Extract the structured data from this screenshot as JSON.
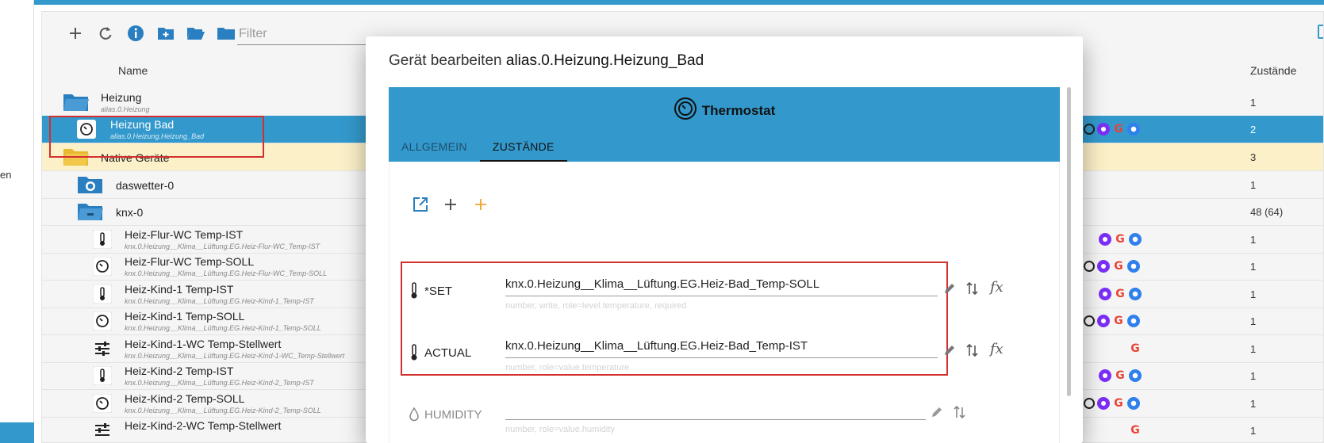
{
  "left_fragment": "en",
  "toolbar": {
    "filter_placeholder": "Filter",
    "icons": [
      "plus-icon",
      "refresh-icon",
      "info-icon",
      "create-folder-icon",
      "open-folder-icon",
      "folder-icon"
    ]
  },
  "columns": {
    "name": "Name",
    "states": "Zustände"
  },
  "rows": [
    {
      "name": "Heizung",
      "sub": "alias.0.Heizung",
      "count": "1",
      "icon": "folder-icon",
      "badges": []
    },
    {
      "name": "Heizung Bad",
      "sub": "alias.0.Heizung.Heizung_Bad",
      "count": "2",
      "icon": "thermostat-icon",
      "badges": [
        "ring",
        "alexa",
        "google",
        "blue"
      ]
    },
    {
      "name": "Native Geräte",
      "sub": "",
      "count": "3",
      "icon": "folder-icon",
      "badges": []
    },
    {
      "name": "daswetter-0",
      "sub": "",
      "count": "1",
      "icon": "weather-icon",
      "badges": []
    },
    {
      "name": "knx-0",
      "sub": "",
      "count": "48 (64)",
      "icon": "folder-icon",
      "badges": []
    },
    {
      "name": "Heiz-Flur-WC Temp-IST",
      "sub": "knx.0.Heizung__Klima__Lüftung.EG.Heiz-Flur-WC_Temp-IST",
      "count": "1",
      "icon": "thermometer-icon",
      "badges": [
        "alexa",
        "google",
        "blue"
      ]
    },
    {
      "name": "Heiz-Flur-WC Temp-SOLL",
      "sub": "knx.0.Heizung__Klima__Lüftung.EG.Heiz-Flur-WC_Temp-SOLL",
      "count": "1",
      "icon": "thermostat-icon",
      "badges": [
        "ring",
        "alexa",
        "google",
        "blue"
      ]
    },
    {
      "name": "Heiz-Kind-1 Temp-IST",
      "sub": "knx.0.Heizung__Klima__Lüftung.EG.Heiz-Kind-1_Temp-IST",
      "count": "1",
      "icon": "thermometer-icon",
      "badges": [
        "alexa",
        "google",
        "blue"
      ]
    },
    {
      "name": "Heiz-Kind-1 Temp-SOLL",
      "sub": "knx.0.Heizung__Klima__Lüftung.EG.Heiz-Kind-1_Temp-SOLL",
      "count": "1",
      "icon": "thermostat-icon",
      "badges": [
        "ring",
        "alexa",
        "google",
        "blue"
      ]
    },
    {
      "name": "Heiz-Kind-1-WC Temp-Stellwert",
      "sub": "knx.0.Heizung__Klima__Lüftung.EG.Heiz-Kind-1-WC_Temp-Stellwert",
      "count": "1",
      "icon": "sliders-icon",
      "badges": [
        "google"
      ]
    },
    {
      "name": "Heiz-Kind-2 Temp-IST",
      "sub": "knx.0.Heizung__Klima__Lüftung.EG.Heiz-Kind-2_Temp-IST",
      "count": "1",
      "icon": "thermometer-icon",
      "badges": [
        "alexa",
        "google",
        "blue"
      ]
    },
    {
      "name": "Heiz-Kind-2 Temp-SOLL",
      "sub": "knx.0.Heizung__Klima__Lüftung.EG.Heiz-Kind-2_Temp-SOLL",
      "count": "1",
      "icon": "thermostat-icon",
      "badges": [
        "ring",
        "alexa",
        "google",
        "blue"
      ]
    },
    {
      "name": "Heiz-Kind-2-WC Temp-Stellwert",
      "sub": "",
      "count": "1",
      "icon": "sliders-icon",
      "badges": [
        "google"
      ]
    }
  ],
  "dialog": {
    "title_prefix": "Gerät bearbeiten",
    "title_path": "alias.0.Heizung.Heizung_Bad",
    "device_type": "Thermostat",
    "tabs": [
      {
        "label": "ALLGEMEIN",
        "active": false
      },
      {
        "label": "ZUSTÄNDE",
        "active": true
      }
    ],
    "states": [
      {
        "label": "*SET",
        "value": "knx.0.Heizung__Klima__Lüftung.EG.Heiz-Bad_Temp-SOLL",
        "hint": "number, write, role=level.temperature, required",
        "icon": "thermometer-icon",
        "enabled": true
      },
      {
        "label": "ACTUAL",
        "value": "knx.0.Heizung__Klima__Lüftung.EG.Heiz-Bad_Temp-IST",
        "hint": "number, role=value.temperature",
        "icon": "thermometer-icon",
        "enabled": true
      },
      {
        "label": "HUMIDITY",
        "value": "",
        "hint": "number, role=value.humidity",
        "icon": "humidity-icon",
        "enabled": false
      }
    ]
  },
  "colors": {
    "accent": "#3399cc",
    "highlight_yellow": "#fbf0c8",
    "annotation_red": "#d32f2f",
    "add_orange": "#f0a030"
  }
}
